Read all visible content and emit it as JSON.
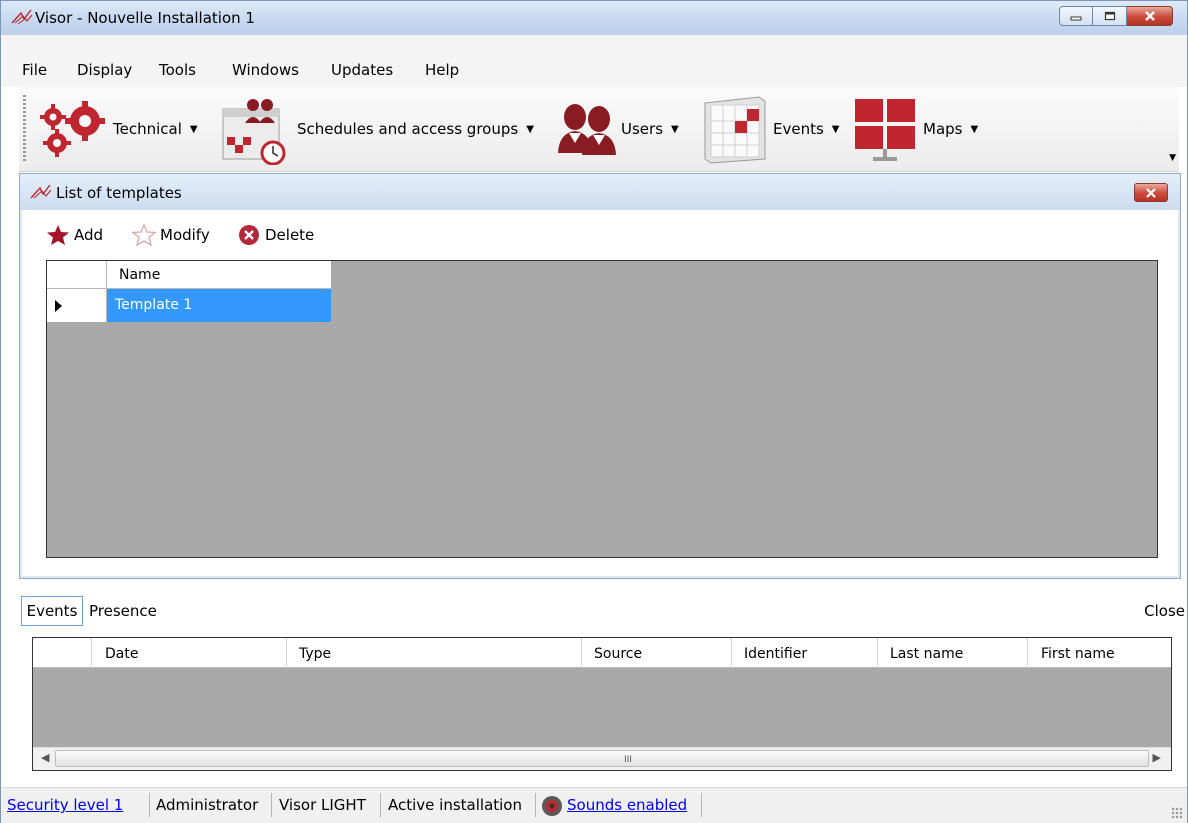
{
  "window": {
    "title": "Visor - Nouvelle Installation 1",
    "icon": "visor-logo-icon"
  },
  "menu": [
    "File",
    "Display",
    "Tools",
    "Windows",
    "Updates",
    "Help"
  ],
  "toolbar": {
    "items": [
      {
        "label": "Technical",
        "icon": "gears-icon"
      },
      {
        "label": "Schedules and access groups",
        "icon": "calendar-clock-icon"
      },
      {
        "label": "Users",
        "icon": "users-icon"
      },
      {
        "label": "Events",
        "icon": "events-calendar-icon"
      },
      {
        "label": "Maps",
        "icon": "maps-icon"
      }
    ]
  },
  "templates_window": {
    "title": "List of templates",
    "actions": {
      "add": "Add",
      "modify": "Modify",
      "delete": "Delete"
    },
    "grid": {
      "columns": [
        "Name"
      ],
      "rows": [
        [
          "Template 1"
        ]
      ]
    }
  },
  "bottom_panel": {
    "tabs": [
      "Events",
      "Presence"
    ],
    "close_label": "Close",
    "columns": [
      "Date",
      "Type",
      "Source",
      "Identifier",
      "Last name",
      "First name"
    ],
    "scroll_grip": "III"
  },
  "statusbar": {
    "security_level": "Security level 1",
    "role": "Administrator",
    "edition": "Visor LIGHT",
    "installation": "Active installation",
    "sounds": "Sounds enabled"
  },
  "colors": {
    "accent_red": "#c0262f",
    "selection": "#3399ff",
    "grid_background": "#a9a9a9"
  }
}
